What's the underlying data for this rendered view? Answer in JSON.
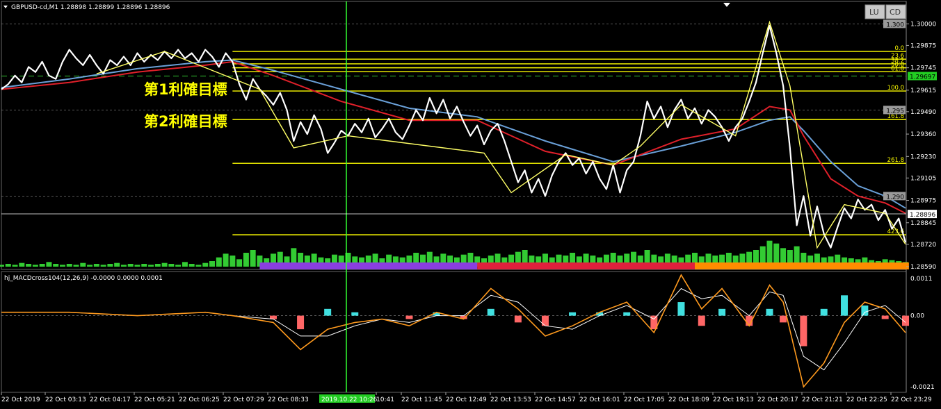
{
  "header": {
    "symbol_line": "GBPUSD-cd,M1  1.28898 1.28899 1.28896 1.28896",
    "indicator_line": "hj_MACDcross104(12,26,9) -0.0000 0.0000 0.0001"
  },
  "buttons": {
    "lu": "LU",
    "cd": "CD"
  },
  "annotations": {
    "target1": "第1利確目標",
    "target2": "第2利確目標"
  },
  "colors": {
    "background": "#000000",
    "fib": "#ffff00",
    "price_line": "#ffffff",
    "zigzag": "#ffff66",
    "ma_blue": "#6aa0d8",
    "ma_red": "#e0202a",
    "volume": "#33cc33",
    "vertical_line": "#33ff33",
    "session_asia": "#8a3ee0",
    "session_europe": "#e0203c",
    "session_ny": "#ff8c00",
    "macd_main": "#ff9a1e",
    "macd_signal": "#ffffff",
    "hist_pos": "#40e0e0",
    "hist_neg": "#ff6666",
    "price_badge": "#22cc22"
  },
  "chart_data": [
    {
      "type": "line",
      "name": "main",
      "ylim": [
        1.2859,
        1.3005
      ],
      "y_ticks": [
        "1.30000",
        "1.29875",
        "1.29745",
        "1.29615",
        "1.29490",
        "1.29360",
        "1.29230",
        "1.29105",
        "1.28975",
        "1.28845",
        "1.28720",
        "1.28590"
      ],
      "price_labels": [
        {
          "text": "1.300",
          "value": 1.3
        },
        {
          "text": "1.295",
          "value": 1.295
        },
        {
          "text": "1.290",
          "value": 1.29
        }
      ],
      "current_price": {
        "text": "1.28896",
        "value": 1.28896
      },
      "marker_price": {
        "text": "1.29697",
        "value": 1.29697
      },
      "fib_levels": [
        {
          "label": "0.0",
          "value": 1.2984
        },
        {
          "label": "23.6",
          "value": 1.29795
        },
        {
          "label": "38.2",
          "value": 1.29768
        },
        {
          "label": "50.0",
          "value": 1.29745
        },
        {
          "label": "61.8",
          "value": 1.29722
        },
        {
          "label": "100.0",
          "value": 1.2961
        },
        {
          "label": "161.8",
          "value": 1.29445
        },
        {
          "label": "261.8",
          "value": 1.2919
        },
        {
          "label": "423.6",
          "value": 1.28775
        }
      ],
      "x_labels": [
        "22 Oct 2019",
        "22 Oct 03:13",
        "22 Oct 04:17",
        "22 Oct 05:21",
        "22 Oct 06:25",
        "22 Oct 07:29",
        "22 Oct 08:33",
        "2019.10.22 10:26",
        "10:41",
        "22 Oct 11:45",
        "22 Oct 12:49",
        "22 Oct 13:53",
        "22 Oct 14:57",
        "22 Oct 16:01",
        "22 Oct 17:05",
        "22 Oct 18:09",
        "22 Oct 19:13",
        "22 Oct 20:17",
        "22 Oct 21:21",
        "22 Oct 22:25",
        "22 Oct 23:29"
      ],
      "price_series": [
        [
          0,
          1.2962
        ],
        [
          1,
          1.2965
        ],
        [
          2,
          1.297
        ],
        [
          3,
          1.2966
        ],
        [
          4,
          1.2975
        ],
        [
          5,
          1.2972
        ],
        [
          6,
          1.2978
        ],
        [
          7,
          1.297
        ],
        [
          8,
          1.2968
        ],
        [
          9,
          1.2978
        ],
        [
          10,
          1.2985
        ],
        [
          11,
          1.298
        ],
        [
          12,
          1.2976
        ],
        [
          13,
          1.2982
        ],
        [
          14,
          1.2976
        ],
        [
          15,
          1.2971
        ],
        [
          16,
          1.2979
        ],
        [
          17,
          1.2976
        ],
        [
          18,
          1.2981
        ],
        [
          19,
          1.2976
        ],
        [
          20,
          1.2983
        ],
        [
          21,
          1.2978
        ],
        [
          22,
          1.2982
        ],
        [
          23,
          1.2979
        ],
        [
          24,
          1.2984
        ],
        [
          25,
          1.298
        ],
        [
          26,
          1.2985
        ],
        [
          27,
          1.298
        ],
        [
          28,
          1.2983
        ],
        [
          29,
          1.2978
        ],
        [
          30,
          1.2985
        ],
        [
          31,
          1.2981
        ],
        [
          32,
          1.2975
        ],
        [
          33,
          1.2983
        ],
        [
          34,
          1.2978
        ],
        [
          35,
          1.2965
        ],
        [
          36,
          1.2956
        ],
        [
          37,
          1.2968
        ],
        [
          38,
          1.2962
        ],
        [
          39,
          1.2958
        ],
        [
          40,
          1.2953
        ],
        [
          41,
          1.296
        ],
        [
          42,
          1.295
        ],
        [
          43,
          1.2932
        ],
        [
          44,
          1.2943
        ],
        [
          45,
          1.2936
        ],
        [
          46,
          1.2947
        ],
        [
          47,
          1.2939
        ],
        [
          48,
          1.2925
        ],
        [
          49,
          1.2931
        ],
        [
          50,
          1.2938
        ],
        [
          51,
          1.2935
        ],
        [
          52,
          1.2942
        ],
        [
          53,
          1.2937
        ],
        [
          54,
          1.2945
        ],
        [
          55,
          1.2934
        ],
        [
          56,
          1.2939
        ],
        [
          57,
          1.2945
        ],
        [
          58,
          1.2937
        ],
        [
          59,
          1.2933
        ],
        [
          60,
          1.2941
        ],
        [
          61,
          1.295
        ],
        [
          62,
          1.2944
        ],
        [
          63,
          1.2957
        ],
        [
          64,
          1.2948
        ],
        [
          65,
          1.2956
        ],
        [
          66,
          1.2945
        ],
        [
          67,
          1.2952
        ],
        [
          68,
          1.2943
        ],
        [
          69,
          1.2935
        ],
        [
          70,
          1.2941
        ],
        [
          71,
          1.293
        ],
        [
          72,
          1.2938
        ],
        [
          73,
          1.2942
        ],
        [
          74,
          1.2932
        ],
        [
          75,
          1.292
        ],
        [
          76,
          1.2908
        ],
        [
          77,
          1.2915
        ],
        [
          78,
          1.2902
        ],
        [
          79,
          1.291
        ],
        [
          80,
          1.29
        ],
        [
          81,
          1.2912
        ],
        [
          82,
          1.292
        ],
        [
          83,
          1.2925
        ],
        [
          84,
          1.2918
        ],
        [
          85,
          1.2922
        ],
        [
          86,
          1.2913
        ],
        [
          87,
          1.292
        ],
        [
          88,
          1.291
        ],
        [
          89,
          1.2904
        ],
        [
          90,
          1.2918
        ],
        [
          91,
          1.2902
        ],
        [
          92,
          1.2915
        ],
        [
          93,
          1.292
        ],
        [
          94,
          1.2935
        ],
        [
          95,
          1.2955
        ],
        [
          96,
          1.2945
        ],
        [
          97,
          1.2952
        ],
        [
          98,
          1.294
        ],
        [
          99,
          1.295
        ],
        [
          100,
          1.2956
        ],
        [
          101,
          1.2945
        ],
        [
          102,
          1.2951
        ],
        [
          103,
          1.2942
        ],
        [
          104,
          1.295
        ],
        [
          105,
          1.2946
        ],
        [
          106,
          1.294
        ],
        [
          107,
          1.2932
        ],
        [
          108,
          1.294
        ],
        [
          109,
          1.2945
        ],
        [
          110,
          1.2955
        ],
        [
          111,
          1.2966
        ],
        [
          112,
          1.2983
        ],
        [
          113,
          1.2999
        ],
        [
          114,
          1.2983
        ],
        [
          115,
          1.2964
        ],
        [
          116,
          1.2928
        ],
        [
          117,
          1.2883
        ],
        [
          118,
          1.29
        ],
        [
          119,
          1.2877
        ],
        [
          120,
          1.2894
        ],
        [
          121,
          1.2878
        ],
        [
          122,
          1.287
        ],
        [
          123,
          1.2882
        ],
        [
          124,
          1.2893
        ],
        [
          125,
          1.2887
        ],
        [
          126,
          1.2898
        ],
        [
          127,
          1.2892
        ],
        [
          128,
          1.2895
        ],
        [
          129,
          1.2886
        ],
        [
          130,
          1.2892
        ],
        [
          131,
          1.2881
        ],
        [
          132,
          1.2887
        ],
        [
          133,
          1.2873
        ]
      ],
      "ma_blue": [
        [
          0,
          1.2963
        ],
        [
          10,
          1.2968
        ],
        [
          20,
          1.2974
        ],
        [
          30,
          1.2978
        ],
        [
          34,
          1.2979
        ],
        [
          40,
          1.2973
        ],
        [
          50,
          1.2962
        ],
        [
          60,
          1.2951
        ],
        [
          70,
          1.2946
        ],
        [
          80,
          1.2932
        ],
        [
          90,
          1.292
        ],
        [
          100,
          1.2929
        ],
        [
          108,
          1.2937
        ],
        [
          113,
          1.2944
        ],
        [
          116,
          1.2946
        ],
        [
          118,
          1.2938
        ],
        [
          122,
          1.292
        ],
        [
          126,
          1.2906
        ],
        [
          130,
          1.29
        ],
        [
          133,
          1.2893
        ]
      ],
      "ma_red": [
        [
          0,
          1.2962
        ],
        [
          10,
          1.2966
        ],
        [
          20,
          1.2972
        ],
        [
          30,
          1.2976
        ],
        [
          34,
          1.2978
        ],
        [
          40,
          1.297
        ],
        [
          50,
          1.2955
        ],
        [
          60,
          1.2944
        ],
        [
          70,
          1.2944
        ],
        [
          80,
          1.2926
        ],
        [
          90,
          1.2918
        ],
        [
          100,
          1.2933
        ],
        [
          108,
          1.2939
        ],
        [
          113,
          1.2952
        ],
        [
          116,
          1.295
        ],
        [
          118,
          1.2935
        ],
        [
          122,
          1.291
        ],
        [
          126,
          1.29
        ],
        [
          130,
          1.2896
        ],
        [
          133,
          1.289
        ]
      ],
      "zigzag": [
        [
          14,
          1.2971
        ],
        [
          24,
          1.2984
        ],
        [
          38,
          1.2962
        ],
        [
          43,
          1.2928
        ],
        [
          51,
          1.2935
        ],
        [
          55,
          1.2933
        ],
        [
          71,
          1.2925
        ],
        [
          75,
          1.2902
        ],
        [
          83,
          1.2924
        ],
        [
          90,
          1.2918
        ],
        [
          94,
          1.2929
        ],
        [
          100,
          1.2953
        ],
        [
          108,
          1.2935
        ],
        [
          113,
          1.3001
        ],
        [
          116,
          1.2964
        ],
        [
          120,
          1.287
        ],
        [
          124,
          1.2895
        ],
        [
          130,
          1.289
        ],
        [
          133,
          1.2872
        ]
      ],
      "volume": [
        2,
        3,
        2,
        4,
        3,
        2,
        3,
        5,
        3,
        2,
        3,
        2,
        4,
        2,
        3,
        2,
        3,
        4,
        2,
        3,
        2,
        3,
        2,
        3,
        4,
        3,
        2,
        5,
        3,
        2,
        4,
        6,
        10,
        14,
        12,
        8,
        15,
        18,
        12,
        9,
        14,
        16,
        11,
        20,
        15,
        12,
        14,
        10,
        9,
        13,
        12,
        15,
        11,
        10,
        12,
        14,
        9,
        13,
        11,
        10,
        12,
        15,
        13,
        16,
        11,
        14,
        12,
        10,
        13,
        15,
        11,
        9,
        12,
        14,
        10,
        13,
        16,
        18,
        12,
        11,
        14,
        10,
        13,
        12,
        15,
        11,
        14,
        12,
        10,
        13,
        15,
        12,
        14,
        16,
        12,
        18,
        13,
        11,
        14,
        12,
        10,
        13,
        15,
        11,
        14,
        12,
        13,
        15,
        12,
        14,
        16,
        18,
        22,
        28,
        25,
        20,
        18,
        22,
        15,
        12,
        14,
        10,
        11,
        13,
        10,
        9,
        8,
        10,
        7,
        6,
        8,
        7,
        6,
        5
      ],
      "sessions": [
        {
          "label": "asia",
          "start": 38,
          "end": 70
        },
        {
          "label": "europe",
          "start": 70,
          "end": 102
        },
        {
          "label": "ny",
          "start": 102,
          "end": 133.5
        }
      ]
    },
    {
      "type": "line",
      "name": "macd",
      "ylim": [
        -0.00022,
        0.00012
      ],
      "y_ticks": [
        "0.0011",
        "0.00",
        "-0.0021"
      ],
      "macd_main": [
        [
          0,
          1e-05
        ],
        [
          10,
          1e-05
        ],
        [
          20,
          0.0
        ],
        [
          30,
          1e-05
        ],
        [
          34,
          0.0
        ],
        [
          40,
          -2e-05
        ],
        [
          44,
          -0.0001
        ],
        [
          48,
          -4e-05
        ],
        [
          52,
          -2e-05
        ],
        [
          56,
          -1e-05
        ],
        [
          60,
          -3e-05
        ],
        [
          64,
          1e-05
        ],
        [
          68,
          -1e-05
        ],
        [
          72,
          8e-05
        ],
        [
          76,
          2e-05
        ],
        [
          80,
          -6e-05
        ],
        [
          84,
          -3e-05
        ],
        [
          88,
          1e-05
        ],
        [
          92,
          4e-05
        ],
        [
          96,
          -5e-05
        ],
        [
          100,
          0.00012
        ],
        [
          103,
          2e-05
        ],
        [
          106,
          8e-05
        ],
        [
          110,
          -3e-05
        ],
        [
          113,
          9e-05
        ],
        [
          115,
          4e-05
        ],
        [
          118,
          -0.00021
        ],
        [
          121,
          -0.00014
        ],
        [
          124,
          -2e-05
        ],
        [
          127,
          4e-05
        ],
        [
          130,
          2e-05
        ],
        [
          133,
          -5e-05
        ]
      ],
      "macd_signal": [
        [
          0,
          1e-05
        ],
        [
          10,
          1e-05
        ],
        [
          20,
          0.0
        ],
        [
          30,
          1e-05
        ],
        [
          34,
          0.0
        ],
        [
          40,
          -1e-05
        ],
        [
          44,
          -6e-05
        ],
        [
          48,
          -6e-05
        ],
        [
          52,
          -3e-05
        ],
        [
          56,
          -1e-05
        ],
        [
          60,
          -2e-05
        ],
        [
          64,
          0.0
        ],
        [
          68,
          0.0
        ],
        [
          72,
          6e-05
        ],
        [
          76,
          4e-05
        ],
        [
          80,
          -3e-05
        ],
        [
          84,
          -4e-05
        ],
        [
          88,
          0.0
        ],
        [
          92,
          3e-05
        ],
        [
          96,
          -1e-05
        ],
        [
          100,
          8e-05
        ],
        [
          103,
          5e-05
        ],
        [
          106,
          6e-05
        ],
        [
          110,
          0.0
        ],
        [
          113,
          7e-05
        ],
        [
          115,
          6e-05
        ],
        [
          118,
          -0.00012
        ],
        [
          121,
          -0.00016
        ],
        [
          124,
          -8e-05
        ],
        [
          127,
          1e-05
        ],
        [
          130,
          3e-05
        ],
        [
          133,
          -2e-05
        ]
      ]
    }
  ]
}
